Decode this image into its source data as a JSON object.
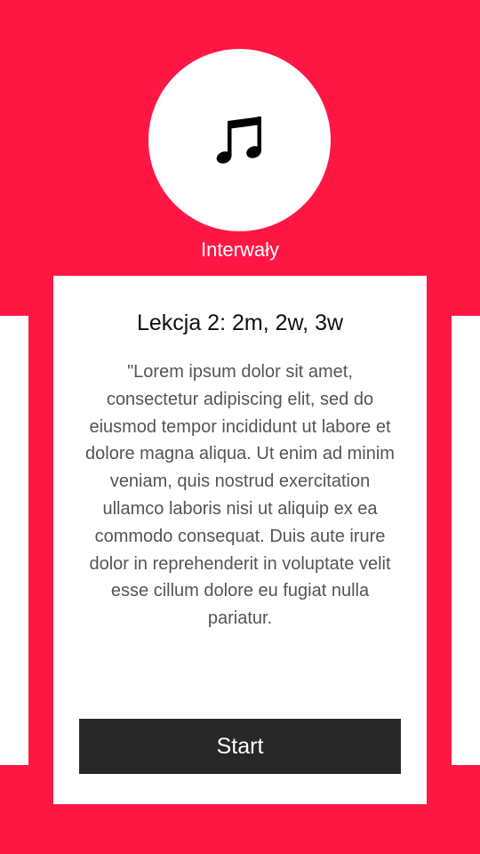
{
  "header": {
    "icon": "music-note-icon",
    "category_label": "Interwały"
  },
  "lesson": {
    "title": "Lekcja 2: 2m, 2w, 3w",
    "description": "\"Lorem ipsum dolor sit amet, consectetur adipiscing elit, sed do eiusmod tempor incididunt ut labore et dolore magna aliqua. Ut enim ad minim veniam, quis nostrud exercitation ullamco laboris nisi ut aliquip ex ea commodo consequat. Duis aute irure dolor in reprehenderit in voluptate velit esse cillum dolore eu fugiat nulla pariatur.",
    "start_label": "Start"
  },
  "colors": {
    "accent": "#ff1744",
    "card": "#ffffff",
    "button": "#282828",
    "body_text": "#555555"
  }
}
